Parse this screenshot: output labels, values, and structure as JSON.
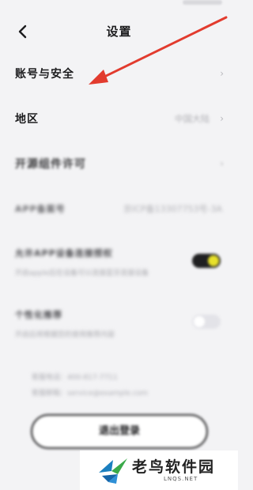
{
  "header": {
    "title": "设置"
  },
  "settings": {
    "rows": [
      {
        "label": "账号与安全",
        "value": "",
        "chevron": "›"
      },
      {
        "label": "地区",
        "value": "中国大陆",
        "chevron": "›"
      },
      {
        "label": "开源组件许可",
        "value": "",
        "chevron": "›"
      },
      {
        "label": "APP备案号",
        "value": "京ICP备13307753号-3A",
        "chevron": ""
      }
    ],
    "toggles": [
      {
        "label": "允许APP设备连接授权",
        "sub": "开启apple后在设备可以连接蓝牙连接设备",
        "state": "on"
      },
      {
        "label": "个性化推荐",
        "sub": "开启后将根据您的使用推荐内容",
        "state": "off"
      }
    ]
  },
  "contact": {
    "line1": "客服电话：400-817-7711",
    "line2": "客服邮箱：service@example.com"
  },
  "logout_label": "退出登录",
  "watermark": {
    "name": "老鸟软件园",
    "url": "LNQS.NET"
  },
  "colors": {
    "arrow": "#e23b2e",
    "toggle_on": "#e8e12a",
    "toggle_track_on": "#1f1f21"
  }
}
